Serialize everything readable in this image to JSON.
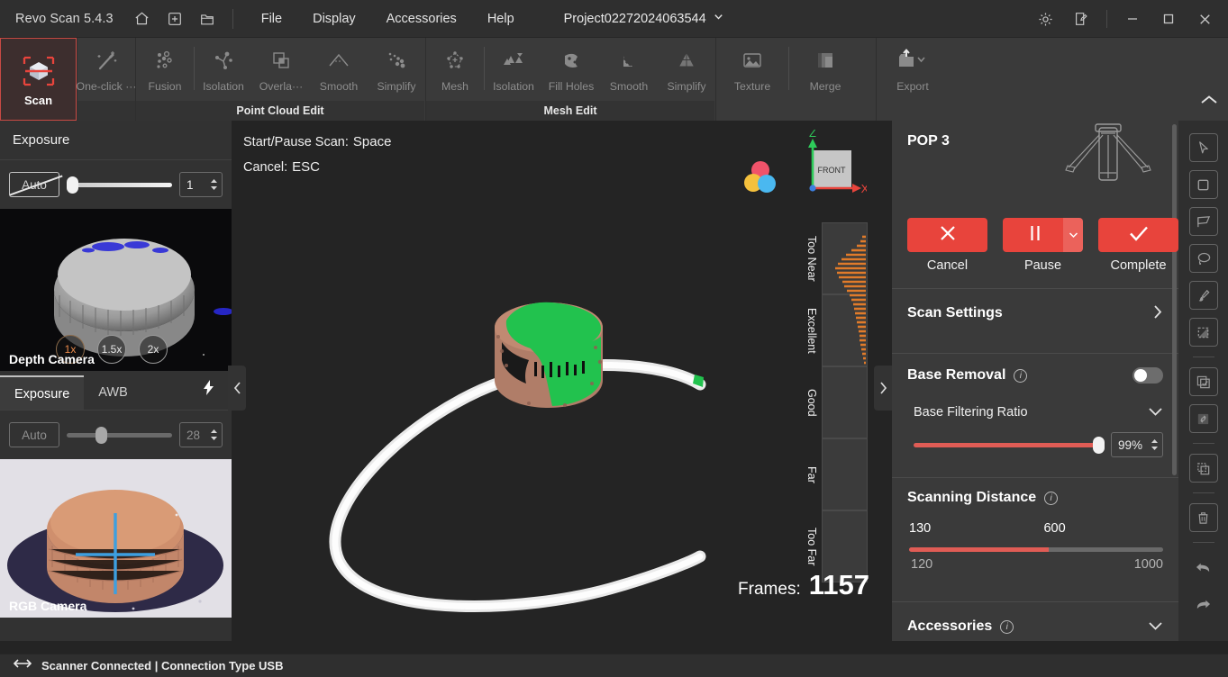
{
  "titlebar": {
    "app_name": "Revo Scan 5.4.3",
    "icons": [
      {
        "name": "home-icon"
      },
      {
        "name": "new-project-icon"
      },
      {
        "name": "open-folder-icon"
      }
    ],
    "menus": [
      "File",
      "Display",
      "Accessories",
      "Help"
    ],
    "project_name": "Project02272024063544",
    "window_icons": [
      "settings-gear-icon",
      "feedback-note-icon"
    ],
    "window_controls": [
      "minimize",
      "maximize",
      "close"
    ]
  },
  "ribbon": {
    "scan": {
      "label": "Scan"
    },
    "oneclick": {
      "label": "One-click ···"
    },
    "point_cloud_edit": {
      "caption": "Point Cloud Edit",
      "items": [
        "Fusion",
        "Isolation",
        "Overla···",
        "Smooth",
        "Simplify"
      ]
    },
    "mesh_edit": {
      "caption": "Mesh Edit",
      "items": [
        "Mesh",
        "Isolation",
        "Fill Holes",
        "Smooth",
        "Simplify"
      ]
    },
    "texture_group": {
      "items": [
        "Texture",
        "Merge"
      ]
    },
    "export": {
      "label": "Export"
    },
    "collapse_icon": "chevron-up-icon"
  },
  "left_panel": {
    "depth": {
      "title": "Exposure",
      "auto_label": "Auto",
      "auto_enabled": false,
      "value": "1",
      "slider_percent": 2,
      "camera_label": "Depth Camera",
      "zoom_options": [
        "1x",
        "1.5x",
        "2x"
      ],
      "zoom_active": "1x"
    },
    "rgb": {
      "tabs": [
        "Exposure",
        "AWB"
      ],
      "active_tab": "Exposure",
      "flash_icon": "flash-bolt-icon",
      "auto_label": "Auto",
      "value": "28",
      "slider_percent": 27,
      "camera_label": "RGB Camera"
    },
    "collapse_icon": "chevron-left-icon"
  },
  "viewport": {
    "hints": [
      {
        "label": "Start/Pause Scan:",
        "key": "Space"
      },
      {
        "label": "Cancel:",
        "key": "ESC"
      }
    ],
    "gizmo": {
      "x": "X",
      "z": "Z",
      "face": "FRONT"
    },
    "color_ball_icon": "color-mode-icon",
    "frames_label": "Frames:",
    "frames_value": "1157",
    "distance_meter": [
      "Too Near",
      "Excellent",
      "Good",
      "Far",
      "Too Far"
    ],
    "collapse_icon": "chevron-right-icon"
  },
  "right_panel": {
    "device_name": "POP 3",
    "device_icon": "tripod-icon",
    "actions": [
      {
        "caption": "Cancel",
        "icon": "close-x-icon",
        "has_caret": false
      },
      {
        "caption": "Pause",
        "icon": "pause-icon",
        "has_caret": true
      },
      {
        "caption": "Complete",
        "icon": "check-icon",
        "has_caret": false
      }
    ],
    "scan_settings": {
      "label": "Scan Settings",
      "chevron": "chevron-right-icon"
    },
    "base_removal": {
      "label": "Base Removal",
      "toggle_on": false,
      "sub_label": "Base Filtering Ratio",
      "value": "99%",
      "slider_percent": 96
    },
    "scanning_distance": {
      "label": "Scanning Distance",
      "min_marker": "130",
      "current_marker": "600",
      "min_range": "120",
      "max_range": "1000",
      "left_percent": 2,
      "right_percent": 55
    },
    "accessories": {
      "label": "Accessories",
      "chevron": "chevron-down-icon"
    }
  },
  "toolstrip": {
    "tools": [
      "cursor-select-icon",
      "rectangle-select-icon",
      "polygon-select-icon",
      "lasso-select-icon",
      "brush-icon",
      "gradient-select-icon",
      "select-all-icon",
      "invert-selection-icon",
      "copy-icon",
      "delete-trash-icon",
      "undo-icon",
      "redo-icon"
    ]
  },
  "statusbar": {
    "connection_icon": "usb-connection-icon",
    "text": "Scanner Connected | Connection Type USB"
  },
  "colors": {
    "accent_red": "#e8443c",
    "slider_red": "#e05c55",
    "active_orange": "#e8894a",
    "scan_green": "#22c24e",
    "axis_z_green": "#2ecc5a",
    "axis_x_red": "#e8443c",
    "panel_bg": "#3a3a3a",
    "ribbon_bg": "#3a3a3a",
    "viewport_bg": "#242424"
  }
}
